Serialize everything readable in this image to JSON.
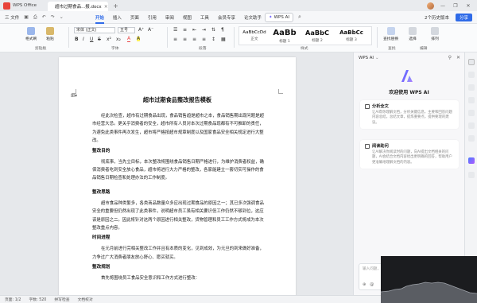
{
  "titlebar": {
    "app_name": "WPS Office",
    "tab_title": "超市过期食品...报.docx",
    "tab_close": "×",
    "new_tab": "+",
    "window_controls": [
      "—",
      "❐",
      "✕"
    ]
  },
  "menubar": {
    "file_label": "三 文件",
    "tabs": [
      "开始",
      "插入",
      "页面",
      "引用",
      "审阅",
      "视图",
      "工具",
      "会员专享",
      "论文助手"
    ],
    "active_tab": "开始",
    "wps_ai_label": "WPS AI",
    "collab_label": "2个历史版本",
    "share_label": "分享"
  },
  "ribbon": {
    "group_labels": [
      "剪贴板",
      "字体",
      "段落",
      "样式",
      "查找",
      "编辑"
    ],
    "format_brush": "格式刷",
    "paste": "粘贴",
    "font_name": "宋体 (正文)",
    "font_size": "五号",
    "styles": [
      {
        "sample": "AaBbCcDd",
        "name": "正文"
      },
      {
        "sample": "AaBb",
        "name": "标题 1"
      },
      {
        "sample": "AaBbC",
        "name": "标题 2"
      },
      {
        "sample": "AaBbCc",
        "name": "标题 3"
      }
    ],
    "find_replace": "查找替换",
    "select": "选择",
    "sort": "排列"
  },
  "document": {
    "title": "超市过期食品整改报告模板",
    "blocks": [
      {
        "type": "para",
        "text": "经此次检查，超市有过期食品出现，食品销售趋是超市之本，食品销售期出现问题是超市经营大忌。更关乎消费者的安全，超市所有人员对本次过期食品现都有不可推卸的责任，为避免此类事件再次发生，超市将严格按超市规章制度以及国家食品安全相关规定进行大整改。"
      },
      {
        "type": "heading",
        "text": "整改目的"
      },
      {
        "type": "para",
        "text": "彻底事，当先立目标，本次整改将围绕食品销售日期严格进行，为维护消费者权益，确保消费者吃到安全放心食品，超市将进行大力严格的整改，各家能建立一套切实可操作的食品销售日期检查和处理办法的工作制度。"
      },
      {
        "type": "heading",
        "text": "整改思路"
      },
      {
        "type": "para",
        "text": "超市食品种类繁多，各类商品数量众多应出现过期食品的原因之一；其已多次强调食品安全的重要但仍然出现了此类事件，说明超市员工虽有相关要识但工作仍然不够到位，这应该是原因之二。因此将针对这两个原因进行相关整改，货物管理和员工工作方式将成为本次整改重点内容。"
      },
      {
        "type": "heading",
        "text": "时间进程"
      },
      {
        "type": "para",
        "text": "在元月前进行完相关整改工作并且有本质的变化，见到成效，为元旦的到来做好准备，力争过广大消费者朋友放心舒心、愿买就买。"
      },
      {
        "type": "heading",
        "text": "整改规划"
      },
      {
        "type": "para",
        "text": "首先将围绕员工食品安全意识和工作方式进行整改："
      }
    ]
  },
  "statusbar": {
    "page": "页面: 1/2",
    "words": "字数: 520",
    "spell": "拼写检查",
    "proofread": "文档校对"
  },
  "ai_panel": {
    "title": "WPS AI",
    "welcome": "欢迎使用 WPS AI",
    "cards": [
      {
        "title": "分析全文",
        "desc": "让AI帮你理解文档，分析关键信息，主要和回答问题内容总结。总结文章，提炼重要点，提供要理的建议。"
      },
      {
        "title": "阅读助问",
        "desc": "让AI解决你阅读时的问题，向AI提出文档相关的问题，AI会结合文档内容给出更明确的回答，帮助用户更准确地理解文档的内容。"
      }
    ],
    "input_placeholder": "输入问题，@唤起指令"
  },
  "colors": {
    "accent": "#2f6be8",
    "title_bar": "#e9ebee",
    "wps_red": "#e8433a"
  }
}
